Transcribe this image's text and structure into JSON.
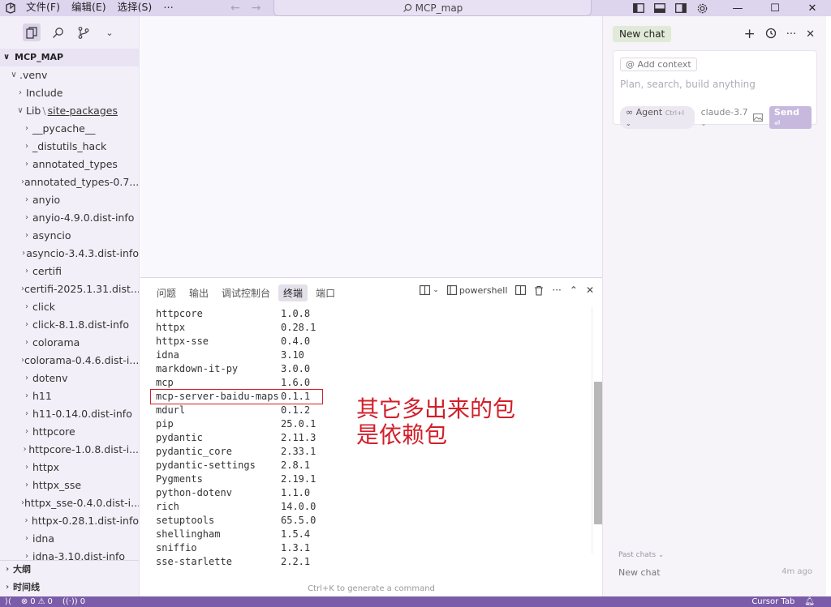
{
  "titlebar": {
    "menus": [
      "文件(F)",
      "编辑(E)",
      "选择(S)"
    ],
    "more": "···",
    "command_center": "MCP_map"
  },
  "sidebar": {
    "root": "MCP_MAP",
    "items": [
      {
        "label": ".venv",
        "level": 1,
        "open": true
      },
      {
        "label": "Include",
        "level": 2,
        "open": false
      },
      {
        "label": "Lib",
        "level": 2,
        "open": true,
        "suffix": "site-packages"
      },
      {
        "label": "__pycache__",
        "level": 3
      },
      {
        "label": "_distutils_hack",
        "level": 3
      },
      {
        "label": "annotated_types",
        "level": 3
      },
      {
        "label": "annotated_types-0.7...",
        "level": 3
      },
      {
        "label": "anyio",
        "level": 3
      },
      {
        "label": "anyio-4.9.0.dist-info",
        "level": 3
      },
      {
        "label": "asyncio",
        "level": 3
      },
      {
        "label": "asyncio-3.4.3.dist-info",
        "level": 3
      },
      {
        "label": "certifi",
        "level": 3
      },
      {
        "label": "certifi-2025.1.31.dist...",
        "level": 3
      },
      {
        "label": "click",
        "level": 3
      },
      {
        "label": "click-8.1.8.dist-info",
        "level": 3
      },
      {
        "label": "colorama",
        "level": 3
      },
      {
        "label": "colorama-0.4.6.dist-i...",
        "level": 3
      },
      {
        "label": "dotenv",
        "level": 3
      },
      {
        "label": "h11",
        "level": 3
      },
      {
        "label": "h11-0.14.0.dist-info",
        "level": 3
      },
      {
        "label": "httpcore",
        "level": 3
      },
      {
        "label": "httpcore-1.0.8.dist-i...",
        "level": 3
      },
      {
        "label": "httpx",
        "level": 3
      },
      {
        "label": "httpx_sse",
        "level": 3
      },
      {
        "label": "httpx_sse-0.4.0.dist-i...",
        "level": 3
      },
      {
        "label": "httpx-0.28.1.dist-info",
        "level": 3
      },
      {
        "label": "idna",
        "level": 3
      },
      {
        "label": "idna-3.10.dist-info",
        "level": 3
      }
    ],
    "outline": "大纲",
    "timeline": "时间线"
  },
  "panel": {
    "tabs": [
      "问题",
      "输出",
      "调试控制台",
      "终端",
      "端口"
    ],
    "active_tab": 3,
    "shell": "powershell",
    "packages": [
      [
        "httpcore",
        "1.0.8"
      ],
      [
        "httpx",
        "0.28.1"
      ],
      [
        "httpx-sse",
        "0.4.0"
      ],
      [
        "idna",
        "3.10"
      ],
      [
        "markdown-it-py",
        "3.0.0"
      ],
      [
        "mcp",
        "1.6.0"
      ],
      [
        "mcp-server-baidu-maps",
        "0.1.1"
      ],
      [
        "mdurl",
        "0.1.2"
      ],
      [
        "pip",
        "25.0.1"
      ],
      [
        "pydantic",
        "2.11.3"
      ],
      [
        "pydantic_core",
        "2.33.1"
      ],
      [
        "pydantic-settings",
        "2.8.1"
      ],
      [
        "Pygments",
        "2.19.1"
      ],
      [
        "python-dotenv",
        "1.1.0"
      ],
      [
        "rich",
        "14.0.0"
      ],
      [
        "setuptools",
        "65.5.0"
      ],
      [
        "shellingham",
        "1.5.4"
      ],
      [
        "sniffio",
        "1.3.1"
      ],
      [
        "sse-starlette",
        "2.2.1"
      ]
    ],
    "annotation_line1": "其它多出来的包",
    "annotation_line2": "是依赖包",
    "annotation_color": "#d21f2a",
    "ctrl_k_hint": "Ctrl+K to generate a command"
  },
  "chat": {
    "tab": "New chat",
    "add_context": "@ Add context",
    "placeholder": "Plan, search, build anything",
    "agent": "∞ Agent",
    "agent_shortcut": "Ctrl+I",
    "model": "claude-3.7",
    "send": "Send",
    "past_chats": "Past chats",
    "history_item": "New chat",
    "history_time": "4m ago"
  },
  "statusbar": {
    "errors": "0",
    "warnings": "0",
    "ports": "0",
    "right": "Cursor Tab"
  },
  "colors": {
    "titlebar": "#ddd4ee",
    "statusbar": "#7a5ca8",
    "sidebar": "#f3eff8"
  }
}
